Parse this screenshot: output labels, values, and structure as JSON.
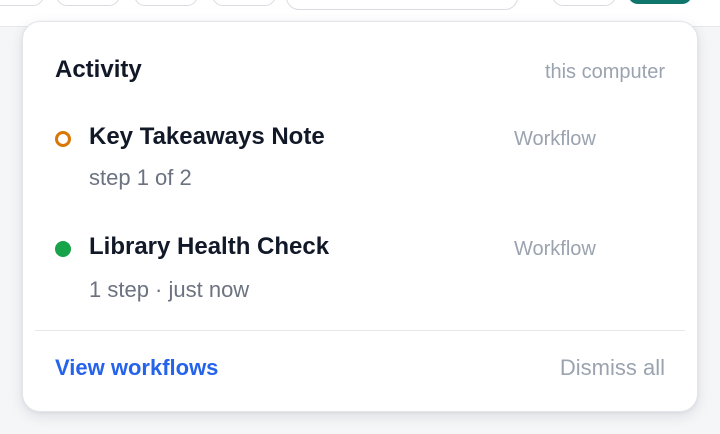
{
  "popover": {
    "title": "Activity",
    "scope": "this computer",
    "items": [
      {
        "status": "in-progress",
        "title": "Key Takeaways Note",
        "type": "Workflow",
        "detail": "step 1 of 2"
      },
      {
        "status": "completed",
        "title": "Library Health Check",
        "type": "Workflow",
        "detail": "1 step · just now"
      }
    ],
    "footer": {
      "primary_label": "View workflows",
      "secondary_label": "Dismiss all"
    }
  },
  "colors": {
    "pending": "#d97706",
    "completed": "#16a34a",
    "link": "#2563eb",
    "accent": "#0f766e"
  }
}
